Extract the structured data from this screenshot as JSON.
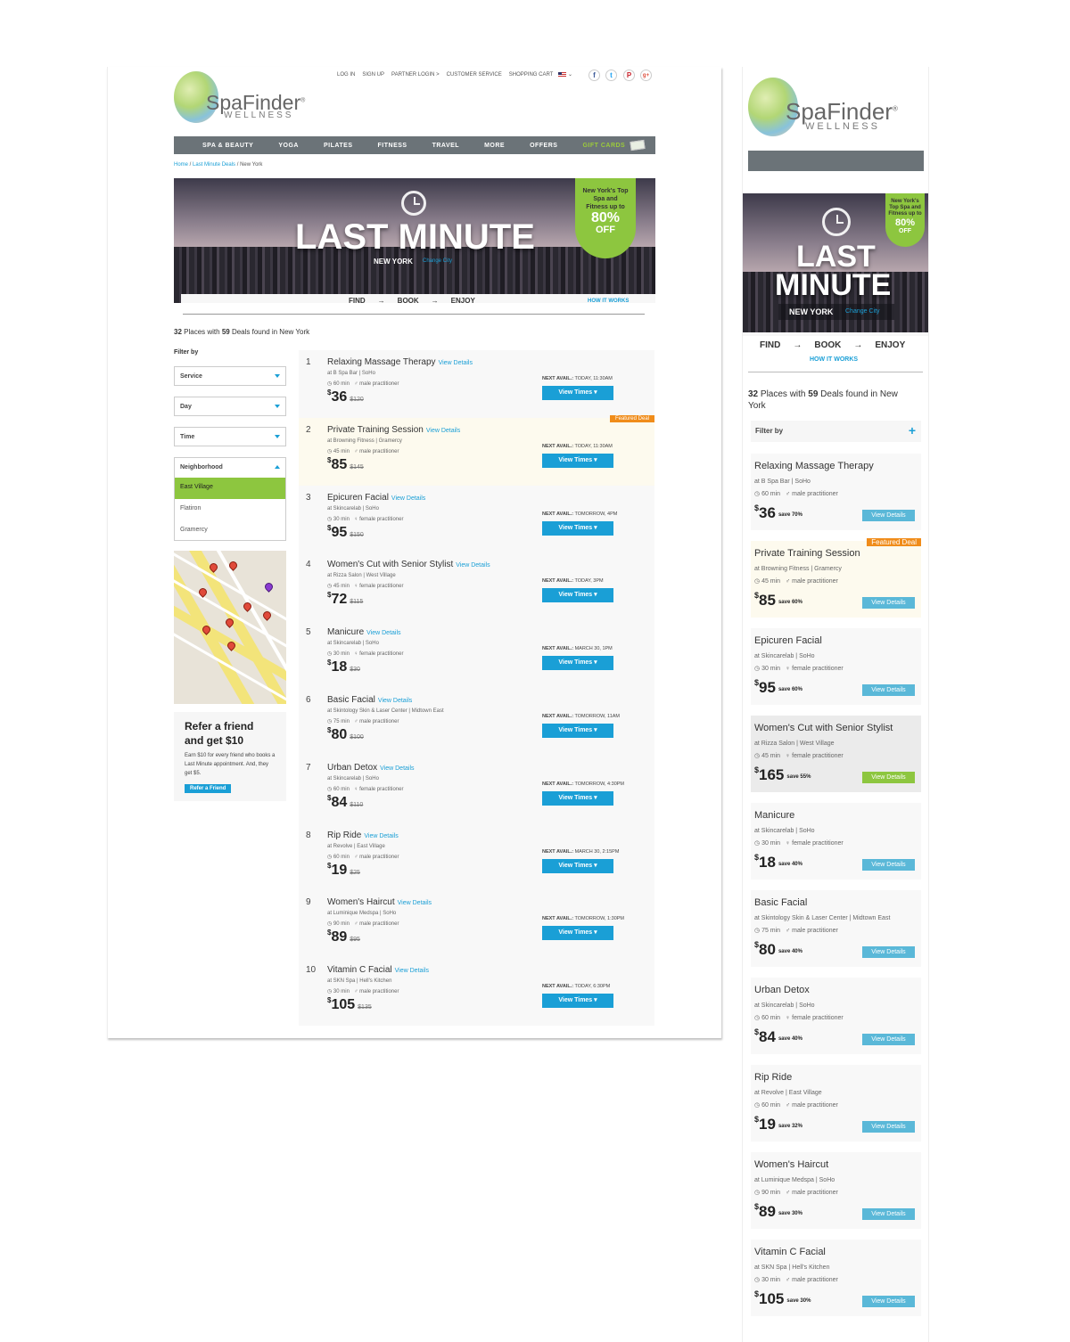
{
  "desktop": {
    "brand": {
      "name": "SpaFinder",
      "sub": "WELLNESS",
      "reg": "®"
    },
    "top_links": [
      "LOG IN",
      "SIGN UP",
      "PARTNER LOGIN >",
      "CUSTOMER SERVICE",
      "SHOPPING CART"
    ],
    "social_icons": [
      "facebook-icon",
      "twitter-icon",
      "pinterest-icon",
      "googleplus-icon"
    ],
    "social_glyphs": [
      "f",
      "t",
      "P",
      "g+"
    ],
    "nav": [
      "SPA & BEAUTY",
      "YOGA",
      "PILATES",
      "FITNESS",
      "TRAVEL",
      "MORE",
      "OFFERS",
      "GIFT CARDS"
    ],
    "breadcrumb": {
      "home": "Home",
      "sep": " / ",
      "deals": "Last Minute Deals",
      "current": "New York"
    },
    "hero": {
      "title": "LAST MINUTE",
      "city": "NEW YORK",
      "change": "Change City",
      "badge_text": "New York's Top Spa and Fitness up to",
      "badge_pct": "80%",
      "badge_off": "OFF"
    },
    "steps": {
      "find": "FIND",
      "book": "BOOK",
      "enjoy": "ENJOY",
      "arrow": "→",
      "how": "HOW IT WORKS"
    },
    "summary": {
      "places": "32",
      "places_label": " Places with ",
      "deals": "59",
      "deals_label": " Deals found in New York"
    },
    "filter": {
      "label": "Filter by",
      "service": "Service",
      "day": "Day",
      "time": "Time",
      "neighborhood": "Neighborhood",
      "options": [
        "East Village",
        "Flatiron",
        "Gramercy"
      ]
    },
    "refer": {
      "title": "Refer a friend and get $10",
      "text": "Earn $10 for every friend who books a Last Minute appointment. And, they get $5.",
      "button": "Refer a Friend"
    },
    "view_details": "View Details",
    "view_times": "View Times ▾",
    "featured": "Featured Deal",
    "avail_label": "NEXT AVAIL.:",
    "listings": [
      {
        "num": "1",
        "name": "Relaxing Massage Therapy",
        "venue": "at B Spa Bar | SoHo",
        "dur": "60 min",
        "pract": "male practitioner",
        "price": "36",
        "old": "$120",
        "avail": "TODAY, 11:30AM",
        "featured": false
      },
      {
        "num": "2",
        "name": "Private Training Session",
        "venue": "at Browning Fitness | Gramercy",
        "dur": "45 min",
        "pract": "male practitioner",
        "price": "85",
        "old": "$145",
        "avail": "TODAY, 11:30AM",
        "featured": true
      },
      {
        "num": "3",
        "name": "Epicuren Facial",
        "venue": "at Skincarelab | SoHo",
        "dur": "30 min",
        "pract": "female practitioner",
        "price": "95",
        "old": "$150",
        "avail": "TOMORROW, 4PM",
        "featured": false
      },
      {
        "num": "4",
        "name": "Women's Cut with Senior Stylist",
        "venue": "at Rizza Salon | West Village",
        "dur": "45 min",
        "pract": "female practitioner",
        "price": "72",
        "old": "$115",
        "avail": "TODAY, 3PM",
        "featured": false
      },
      {
        "num": "5",
        "name": "Manicure",
        "venue": "at Skincarelab | SoHo",
        "dur": "30 min",
        "pract": "female practitioner",
        "price": "18",
        "old": "$30",
        "avail": "MARCH 30, 1PM",
        "featured": false
      },
      {
        "num": "6",
        "name": "Basic Facial",
        "venue": "at Skintology Skin & Laser Center | Midtown East",
        "dur": "75 min",
        "pract": "male practitioner",
        "price": "80",
        "old": "$100",
        "avail": "TOMORROW, 11AM",
        "featured": false
      },
      {
        "num": "7",
        "name": "Urban Detox",
        "venue": "at Skincarelab | SoHo",
        "dur": "60 min",
        "pract": "female practitioner",
        "price": "84",
        "old": "$110",
        "avail": "TOMORROW, 4:30PM",
        "featured": false
      },
      {
        "num": "8",
        "name": "Rip Ride",
        "venue": "at Revolve | East Village",
        "dur": "60 min",
        "pract": "male practitioner",
        "price": "19",
        "old": "$25",
        "avail": "MARCH 30, 2:15PM",
        "featured": false
      },
      {
        "num": "9",
        "name": "Women's Haircut",
        "venue": "at Luminique Medspa | SoHo",
        "dur": "90 min",
        "pract": "male practitioner",
        "price": "89",
        "old": "$95",
        "avail": "TOMORROW, 1:30PM",
        "featured": false
      },
      {
        "num": "10",
        "name": "Vitamin C Facial",
        "venue": "at SKN Spa | Hell's Kitchen",
        "dur": "30 min",
        "pract": "male practitioner",
        "price": "105",
        "old": "$135",
        "avail": "TODAY, 6:30PM",
        "featured": false
      }
    ]
  },
  "mobile": {
    "hero": {
      "line1": "LAST",
      "line2": "MINUTE",
      "city": "NEW YORK",
      "change": "Change City",
      "badge_text": "New York's Top Spa and Fitness up to",
      "badge_pct": "80%",
      "badge_off": "OFF"
    },
    "summary": {
      "places": "32",
      "text": " Places with ",
      "deals": "59",
      "text2": " Deals found in New York"
    },
    "filter_label": "Filter by",
    "filter_plus": "+",
    "view_details": "View Details",
    "featured": "Featured Deal",
    "cards": [
      {
        "name": "Relaxing Massage Therapy",
        "venue": "at B Spa Bar | SoHo",
        "dur": "60 min",
        "pract": "male practitioner",
        "price": "36",
        "save": "save 70%",
        "style": ""
      },
      {
        "name": "Private Training Session",
        "venue": "at Browning Fitness | Gramercy",
        "dur": "45 min",
        "pract": "male practitioner",
        "price": "85",
        "save": "save 60%",
        "style": "feat"
      },
      {
        "name": "Epicuren Facial",
        "venue": "at Skincarelab | SoHo",
        "dur": "30 min",
        "pract": "female practitioner",
        "price": "95",
        "save": "save 60%",
        "style": ""
      },
      {
        "name": "Women's Cut with Senior Stylist",
        "venue": "at Rizza Salon | West Village",
        "dur": "45 min",
        "pract": "female practitioner",
        "price": "165",
        "save": "save 55%",
        "style": "gray"
      },
      {
        "name": "Manicure",
        "venue": "at Skincarelab | SoHo",
        "dur": "30 min",
        "pract": "female practitioner",
        "price": "18",
        "save": "save 40%",
        "style": ""
      },
      {
        "name": "Basic Facial",
        "venue": "at Skintology Skin & Laser Center | Midtown East",
        "dur": "75 min",
        "pract": "male practitioner",
        "price": "80",
        "save": "save 40%",
        "style": ""
      },
      {
        "name": "Urban Detox",
        "venue": "at Skincarelab | SoHo",
        "dur": "60 min",
        "pract": "female practitioner",
        "price": "84",
        "save": "save 40%",
        "style": ""
      },
      {
        "name": "Rip Ride",
        "venue": "at Revolve | East Village",
        "dur": "60 min",
        "pract": "male practitioner",
        "price": "19",
        "save": "save 32%",
        "style": ""
      },
      {
        "name": "Women's Haircut",
        "venue": "at Luminique Medspa | SoHo",
        "dur": "90 min",
        "pract": "male practitioner",
        "price": "89",
        "save": "save 30%",
        "style": ""
      },
      {
        "name": "Vitamin C Facial",
        "venue": "at SKN Spa | Hell's Kitchen",
        "dur": "30 min",
        "pract": "male practitioner",
        "price": "105",
        "save": "save 30%",
        "style": ""
      }
    ]
  },
  "colors": {
    "accent": "#1a9fd6",
    "green": "#8dc63f",
    "featured": "#f08c1a",
    "nav": "#6b7378"
  }
}
